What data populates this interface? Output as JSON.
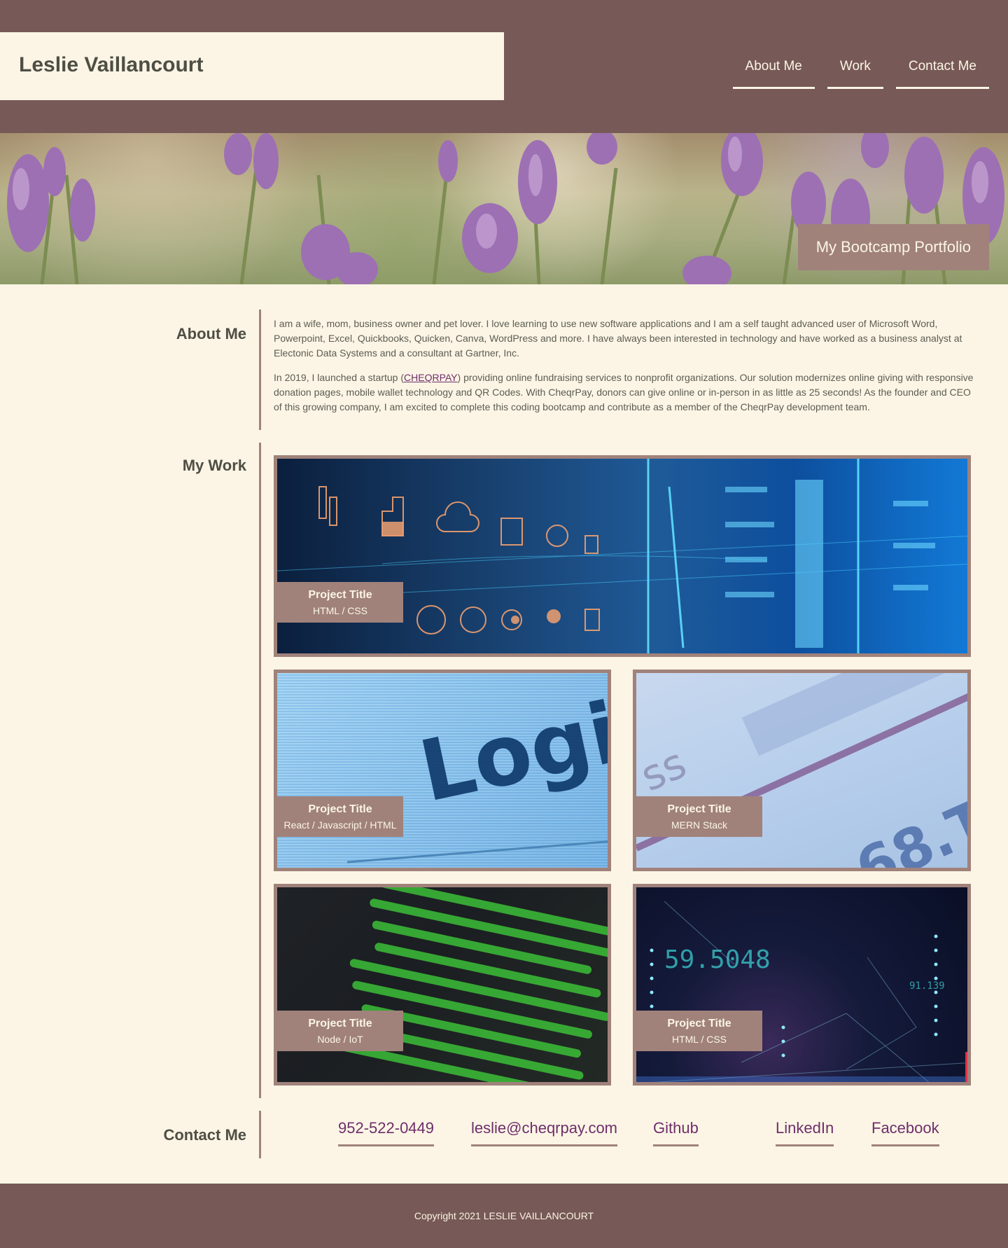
{
  "header": {
    "name": "Leslie Vaillancourt",
    "nav": [
      "About Me",
      "Work",
      "Contact Me"
    ]
  },
  "hero": {
    "badge": "My Bootcamp Portfolio"
  },
  "about": {
    "heading": "About Me",
    "p1": "I am a wife, mom, business owner and pet lover. I love learning to use new software applications and I am a self taught advanced user of Microsoft Word, Powerpoint, Excel, Quickbooks, Quicken, Canva, WordPress and more. I have always been interested in technology and have worked as a business analyst at Electonic Data Systems and a consultant at Gartner, Inc.",
    "p2_before": "In 2019, I launched a startup (",
    "p2_link": "CHEQRPAY",
    "p2_after": ") providing online fundraising services to nonprofit organizations. Our solution modernizes online giving with responsive donation pages, mobile wallet technology and QR Codes. With CheqrPay, donors can give online or in-person in as little as 25 seconds! As the founder and CEO of this growing company, I am excited to complete this coding bootcamp and contribute as a member of the CheqrPay development team."
  },
  "work": {
    "heading": "My Work",
    "projects": [
      {
        "title": "Project Title",
        "stack": "HTML / CSS"
      },
      {
        "title": "Project Title",
        "stack": "React / Javascript / HTML"
      },
      {
        "title": "Project Title",
        "stack": "MERN Stack"
      },
      {
        "title": "Project Title",
        "stack": "Node / IoT"
      },
      {
        "title": "Project Title",
        "stack": "HTML / CSS"
      }
    ]
  },
  "contact": {
    "heading": "Contact Me",
    "links": [
      "952-522-0449",
      "leslie@cheqrpay.com",
      "Github",
      "LinkedIn",
      "Facebook"
    ]
  },
  "footer": {
    "copyright": "Copyright 2021 LESLIE VAILLANCOURT"
  },
  "colors": {
    "background": "#fcf5e5",
    "header": "#775957",
    "accent": "#a0827b",
    "link": "#6e2e6b"
  }
}
